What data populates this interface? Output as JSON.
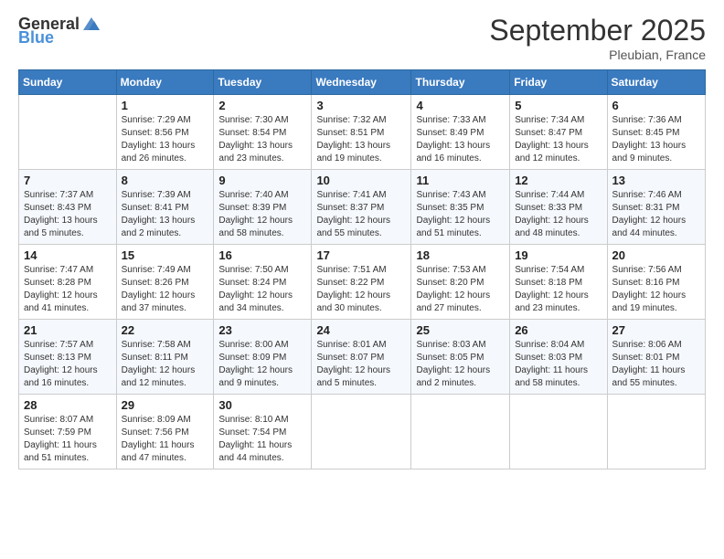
{
  "logo": {
    "general": "General",
    "blue": "Blue"
  },
  "header": {
    "month": "September 2025",
    "location": "Pleubian, France"
  },
  "weekdays": [
    "Sunday",
    "Monday",
    "Tuesday",
    "Wednesday",
    "Thursday",
    "Friday",
    "Saturday"
  ],
  "weeks": [
    [
      {
        "day": "",
        "sunrise": "",
        "sunset": "",
        "daylight": ""
      },
      {
        "day": "1",
        "sunrise": "Sunrise: 7:29 AM",
        "sunset": "Sunset: 8:56 PM",
        "daylight": "Daylight: 13 hours and 26 minutes."
      },
      {
        "day": "2",
        "sunrise": "Sunrise: 7:30 AM",
        "sunset": "Sunset: 8:54 PM",
        "daylight": "Daylight: 13 hours and 23 minutes."
      },
      {
        "day": "3",
        "sunrise": "Sunrise: 7:32 AM",
        "sunset": "Sunset: 8:51 PM",
        "daylight": "Daylight: 13 hours and 19 minutes."
      },
      {
        "day": "4",
        "sunrise": "Sunrise: 7:33 AM",
        "sunset": "Sunset: 8:49 PM",
        "daylight": "Daylight: 13 hours and 16 minutes."
      },
      {
        "day": "5",
        "sunrise": "Sunrise: 7:34 AM",
        "sunset": "Sunset: 8:47 PM",
        "daylight": "Daylight: 13 hours and 12 minutes."
      },
      {
        "day": "6",
        "sunrise": "Sunrise: 7:36 AM",
        "sunset": "Sunset: 8:45 PM",
        "daylight": "Daylight: 13 hours and 9 minutes."
      }
    ],
    [
      {
        "day": "7",
        "sunrise": "Sunrise: 7:37 AM",
        "sunset": "Sunset: 8:43 PM",
        "daylight": "Daylight: 13 hours and 5 minutes."
      },
      {
        "day": "8",
        "sunrise": "Sunrise: 7:39 AM",
        "sunset": "Sunset: 8:41 PM",
        "daylight": "Daylight: 13 hours and 2 minutes."
      },
      {
        "day": "9",
        "sunrise": "Sunrise: 7:40 AM",
        "sunset": "Sunset: 8:39 PM",
        "daylight": "Daylight: 12 hours and 58 minutes."
      },
      {
        "day": "10",
        "sunrise": "Sunrise: 7:41 AM",
        "sunset": "Sunset: 8:37 PM",
        "daylight": "Daylight: 12 hours and 55 minutes."
      },
      {
        "day": "11",
        "sunrise": "Sunrise: 7:43 AM",
        "sunset": "Sunset: 8:35 PM",
        "daylight": "Daylight: 12 hours and 51 minutes."
      },
      {
        "day": "12",
        "sunrise": "Sunrise: 7:44 AM",
        "sunset": "Sunset: 8:33 PM",
        "daylight": "Daylight: 12 hours and 48 minutes."
      },
      {
        "day": "13",
        "sunrise": "Sunrise: 7:46 AM",
        "sunset": "Sunset: 8:31 PM",
        "daylight": "Daylight: 12 hours and 44 minutes."
      }
    ],
    [
      {
        "day": "14",
        "sunrise": "Sunrise: 7:47 AM",
        "sunset": "Sunset: 8:28 PM",
        "daylight": "Daylight: 12 hours and 41 minutes."
      },
      {
        "day": "15",
        "sunrise": "Sunrise: 7:49 AM",
        "sunset": "Sunset: 8:26 PM",
        "daylight": "Daylight: 12 hours and 37 minutes."
      },
      {
        "day": "16",
        "sunrise": "Sunrise: 7:50 AM",
        "sunset": "Sunset: 8:24 PM",
        "daylight": "Daylight: 12 hours and 34 minutes."
      },
      {
        "day": "17",
        "sunrise": "Sunrise: 7:51 AM",
        "sunset": "Sunset: 8:22 PM",
        "daylight": "Daylight: 12 hours and 30 minutes."
      },
      {
        "day": "18",
        "sunrise": "Sunrise: 7:53 AM",
        "sunset": "Sunset: 8:20 PM",
        "daylight": "Daylight: 12 hours and 27 minutes."
      },
      {
        "day": "19",
        "sunrise": "Sunrise: 7:54 AM",
        "sunset": "Sunset: 8:18 PM",
        "daylight": "Daylight: 12 hours and 23 minutes."
      },
      {
        "day": "20",
        "sunrise": "Sunrise: 7:56 AM",
        "sunset": "Sunset: 8:16 PM",
        "daylight": "Daylight: 12 hours and 19 minutes."
      }
    ],
    [
      {
        "day": "21",
        "sunrise": "Sunrise: 7:57 AM",
        "sunset": "Sunset: 8:13 PM",
        "daylight": "Daylight: 12 hours and 16 minutes."
      },
      {
        "day": "22",
        "sunrise": "Sunrise: 7:58 AM",
        "sunset": "Sunset: 8:11 PM",
        "daylight": "Daylight: 12 hours and 12 minutes."
      },
      {
        "day": "23",
        "sunrise": "Sunrise: 8:00 AM",
        "sunset": "Sunset: 8:09 PM",
        "daylight": "Daylight: 12 hours and 9 minutes."
      },
      {
        "day": "24",
        "sunrise": "Sunrise: 8:01 AM",
        "sunset": "Sunset: 8:07 PM",
        "daylight": "Daylight: 12 hours and 5 minutes."
      },
      {
        "day": "25",
        "sunrise": "Sunrise: 8:03 AM",
        "sunset": "Sunset: 8:05 PM",
        "daylight": "Daylight: 12 hours and 2 minutes."
      },
      {
        "day": "26",
        "sunrise": "Sunrise: 8:04 AM",
        "sunset": "Sunset: 8:03 PM",
        "daylight": "Daylight: 11 hours and 58 minutes."
      },
      {
        "day": "27",
        "sunrise": "Sunrise: 8:06 AM",
        "sunset": "Sunset: 8:01 PM",
        "daylight": "Daylight: 11 hours and 55 minutes."
      }
    ],
    [
      {
        "day": "28",
        "sunrise": "Sunrise: 8:07 AM",
        "sunset": "Sunset: 7:59 PM",
        "daylight": "Daylight: 11 hours and 51 minutes."
      },
      {
        "day": "29",
        "sunrise": "Sunrise: 8:09 AM",
        "sunset": "Sunset: 7:56 PM",
        "daylight": "Daylight: 11 hours and 47 minutes."
      },
      {
        "day": "30",
        "sunrise": "Sunrise: 8:10 AM",
        "sunset": "Sunset: 7:54 PM",
        "daylight": "Daylight: 11 hours and 44 minutes."
      },
      {
        "day": "",
        "sunrise": "",
        "sunset": "",
        "daylight": ""
      },
      {
        "day": "",
        "sunrise": "",
        "sunset": "",
        "daylight": ""
      },
      {
        "day": "",
        "sunrise": "",
        "sunset": "",
        "daylight": ""
      },
      {
        "day": "",
        "sunrise": "",
        "sunset": "",
        "daylight": ""
      }
    ]
  ]
}
